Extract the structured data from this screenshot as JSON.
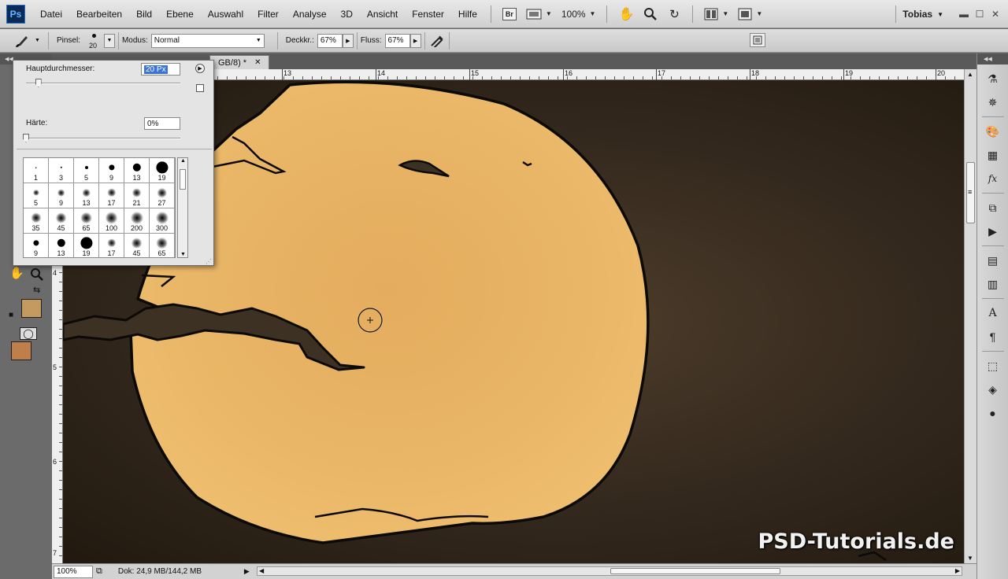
{
  "app": {
    "logo": "Ps"
  },
  "menu": [
    "Datei",
    "Bearbeiten",
    "Bild",
    "Ebene",
    "Auswahl",
    "Filter",
    "Analyse",
    "3D",
    "Ansicht",
    "Fenster",
    "Hilfe"
  ],
  "appbar": {
    "bridge": "Br",
    "zoom": "100%",
    "user": "Tobias"
  },
  "options": {
    "brush_label": "Pinsel:",
    "brush_size": "20",
    "mode_label": "Modus:",
    "mode_value": "Normal",
    "opacity_label": "Deckkr.:",
    "opacity_value": "67%",
    "flow_label": "Fluss:",
    "flow_value": "67%"
  },
  "document": {
    "tab_title": "GB/8) *"
  },
  "ruler_top": [
    "13",
    "14",
    "15",
    "16",
    "17",
    "18",
    "19",
    "20"
  ],
  "ruler_left": [
    "4",
    "5",
    "6",
    "7"
  ],
  "brush_panel": {
    "diameter_label": "Hauptdurchmesser:",
    "diameter_value": "20 Px",
    "diameter_fraction": 0.08,
    "hardness_label": "Härte:",
    "hardness_value": "0%",
    "hardness_fraction": 0,
    "presets": [
      {
        "size": "1",
        "hard": true
      },
      {
        "size": "3",
        "hard": true
      },
      {
        "size": "5",
        "hard": true
      },
      {
        "size": "9",
        "hard": true
      },
      {
        "size": "13",
        "hard": true
      },
      {
        "size": "19",
        "hard": true
      },
      {
        "size": "5",
        "hard": false
      },
      {
        "size": "9",
        "hard": false
      },
      {
        "size": "13",
        "hard": false
      },
      {
        "size": "17",
        "hard": false
      },
      {
        "size": "21",
        "hard": false
      },
      {
        "size": "27",
        "hard": false
      },
      {
        "size": "35",
        "hard": false
      },
      {
        "size": "45",
        "hard": false
      },
      {
        "size": "65",
        "hard": false
      },
      {
        "size": "100",
        "hard": false
      },
      {
        "size": "200",
        "hard": false
      },
      {
        "size": "300",
        "hard": false
      },
      {
        "size": "9",
        "hard": true
      },
      {
        "size": "13",
        "hard": true
      },
      {
        "size": "19",
        "hard": true
      },
      {
        "size": "17",
        "hard": false
      },
      {
        "size": "45",
        "hard": false
      },
      {
        "size": "65",
        "hard": false
      }
    ]
  },
  "status": {
    "zoom": "100%",
    "doc_info": "Dok: 24,9 MB/144,2 MB"
  },
  "watermark": "PSD-Tutorials.de",
  "colors": {
    "foreground": "#c07e4a",
    "background": "#c49a60",
    "moon": "#e8b465"
  }
}
